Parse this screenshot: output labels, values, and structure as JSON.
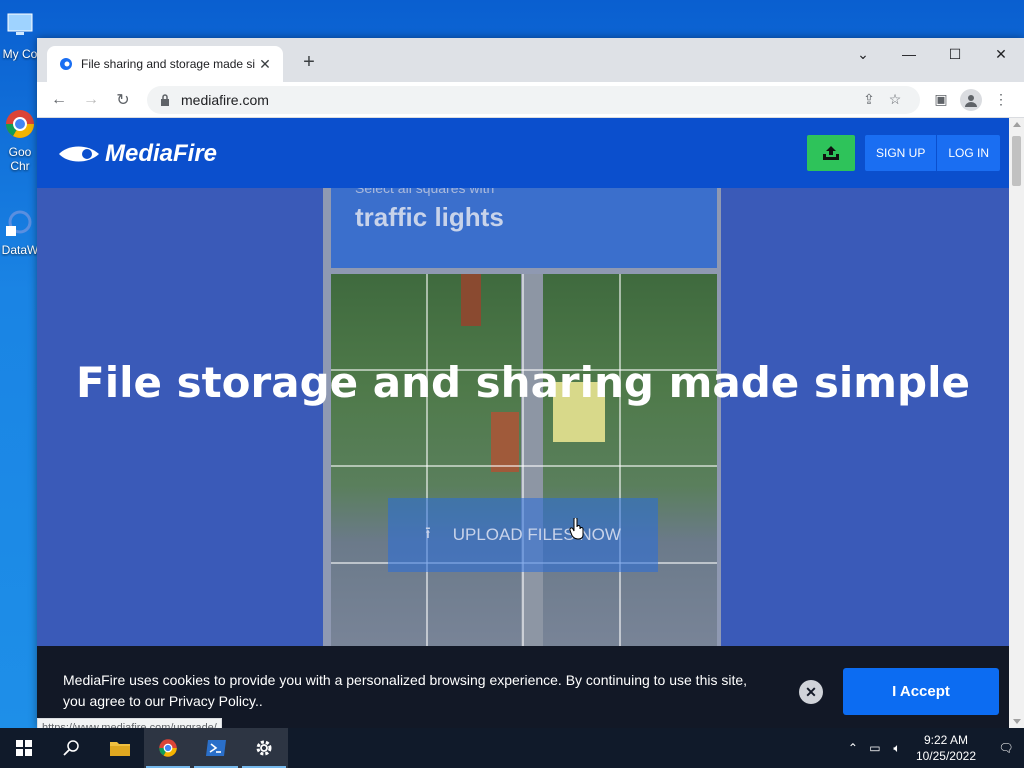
{
  "desktop": {
    "icons": [
      {
        "label": "My Co",
        "name": "my-computer"
      },
      {
        "label": "Goo Chr",
        "name": "google-chrome"
      },
      {
        "label": "DataW",
        "name": "dataw"
      }
    ]
  },
  "browser": {
    "tab": {
      "title": "File sharing and storage made si"
    },
    "new_tab_label": "+",
    "window_controls": {
      "dropdown": "⌄",
      "minimize": "—",
      "maximize": "☐",
      "close": "✕"
    },
    "address": {
      "url": "mediafire.com"
    }
  },
  "site": {
    "logo_text": "MediaFire",
    "signup_label": "SIGN UP",
    "login_label": "LOG IN",
    "hero_title": "File storage and sharing made simple",
    "upload_label": "UPLOAD FILES NOW",
    "captcha": {
      "instruction": "Select all squares with",
      "target": "traffic lights"
    },
    "cookie": {
      "message": "MediaFire uses cookies to provide you with a personalized browsing experience. By continuing to use this site, you agree to our Privacy Policy..",
      "accept_label": "I Accept"
    },
    "status_url": "https://www.mediafire.com/upgrade/"
  },
  "taskbar": {
    "time": "9:22 AM",
    "date": "10/25/2022"
  },
  "colors": {
    "mf_blue": "#0b4fcd",
    "mf_green": "#2ec35a",
    "accept_blue": "#0c6cf2"
  }
}
